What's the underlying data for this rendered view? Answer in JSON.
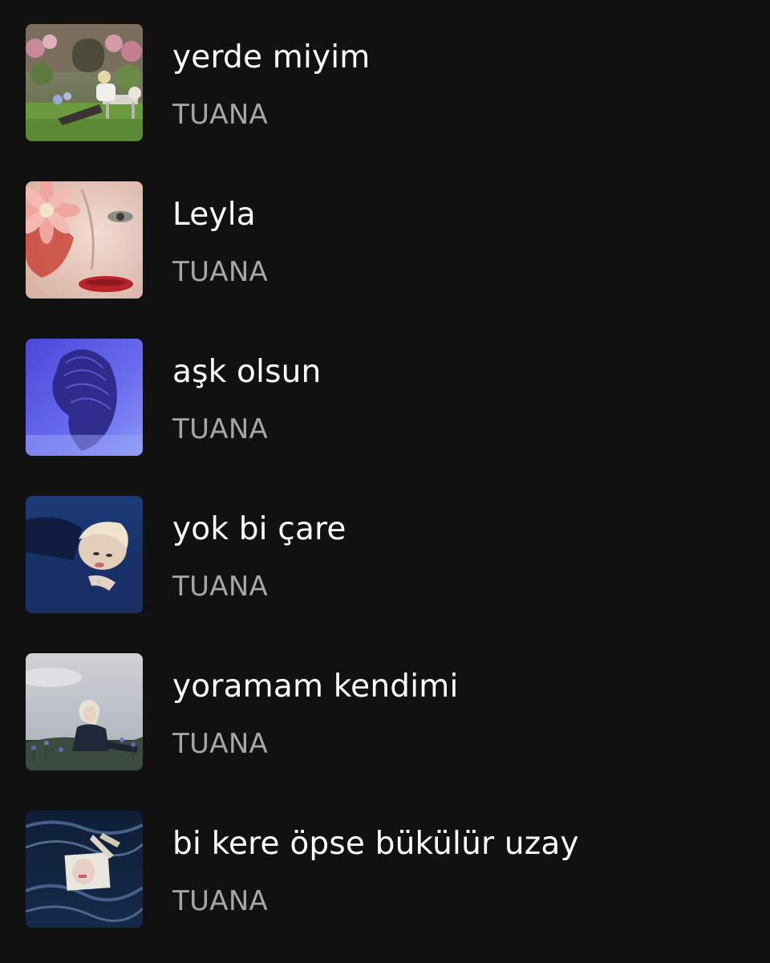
{
  "tracks": [
    {
      "title": "yerde miyim",
      "artist": "TUANA",
      "cover_icon": "album-cover-garden"
    },
    {
      "title": "Leyla",
      "artist": "TUANA",
      "cover_icon": "album-cover-flower-face"
    },
    {
      "title": "aşk olsun",
      "artist": "TUANA",
      "cover_icon": "album-cover-blue-silhouette"
    },
    {
      "title": "yok bi çare",
      "artist": "TUANA",
      "cover_icon": "album-cover-blue-portrait"
    },
    {
      "title": "yoramam kendimi",
      "artist": "TUANA",
      "cover_icon": "album-cover-meadow"
    },
    {
      "title": "bi kere öpse bükülür uzay",
      "artist": "TUANA",
      "cover_icon": "album-cover-water"
    }
  ],
  "colors": {
    "background": "#111112",
    "title": "#ffffff",
    "artist": "#a7a7a7"
  }
}
